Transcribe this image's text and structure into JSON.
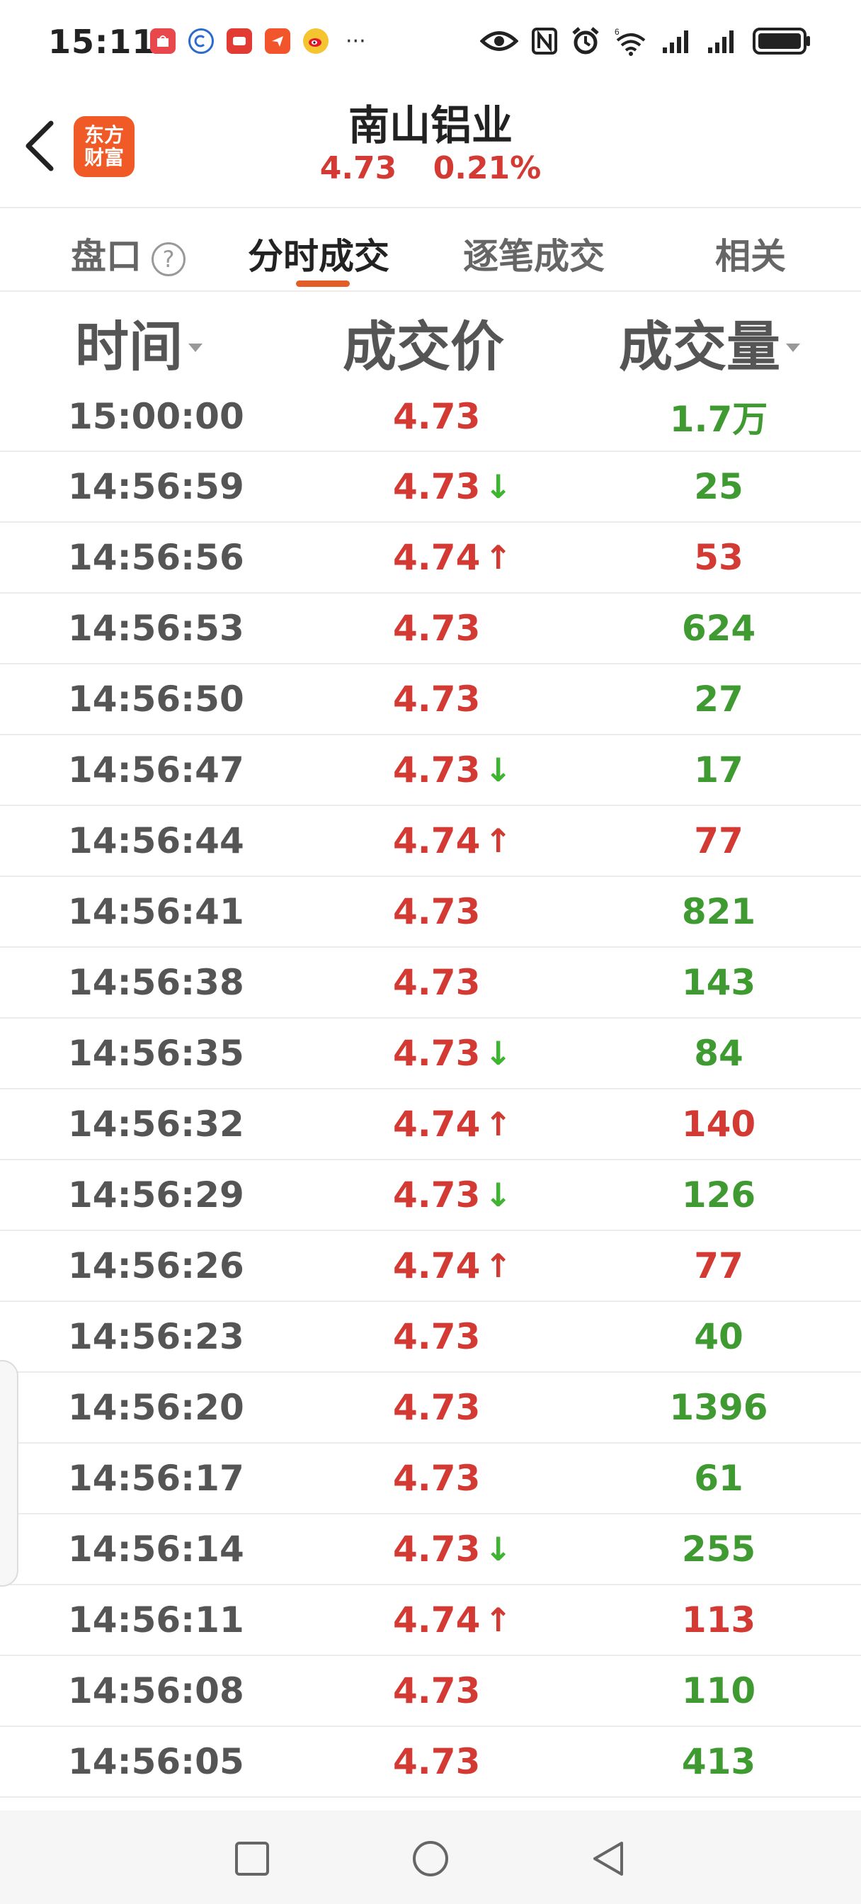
{
  "status_bar": {
    "time": "15:11",
    "more": "···",
    "app_icons": [
      "huawei-store-icon",
      "app-c-icon",
      "red-app-icon",
      "send-app-icon",
      "weibo-icon"
    ],
    "right_icons": [
      "eye-icon",
      "nfc-icon",
      "alarm-icon",
      "wifi-icon",
      "signal-icon",
      "signal-icon",
      "battery-icon"
    ]
  },
  "header": {
    "logo_line1": "东方",
    "logo_line2": "财富",
    "title": "南山铝业",
    "price": "4.73",
    "change_pct": "0.21%"
  },
  "tabs": [
    {
      "label": "盘口",
      "active": false
    },
    {
      "label": "分时成交",
      "active": true
    },
    {
      "label": "逐笔成交",
      "active": false
    },
    {
      "label": "相关",
      "active": false
    }
  ],
  "table": {
    "headers": {
      "time": "时间",
      "price": "成交价",
      "volume": "成交量"
    },
    "rows": [
      {
        "time": "15:00:00",
        "price": "4.73",
        "arrow": "",
        "volume": "1.7万",
        "vol_dir": "down"
      },
      {
        "time": "14:56:59",
        "price": "4.73",
        "arrow": "↓",
        "volume": "25",
        "vol_dir": "down"
      },
      {
        "time": "14:56:56",
        "price": "4.74",
        "arrow": "↑",
        "volume": "53",
        "vol_dir": "up"
      },
      {
        "time": "14:56:53",
        "price": "4.73",
        "arrow": "",
        "volume": "624",
        "vol_dir": "down"
      },
      {
        "time": "14:56:50",
        "price": "4.73",
        "arrow": "",
        "volume": "27",
        "vol_dir": "down"
      },
      {
        "time": "14:56:47",
        "price": "4.73",
        "arrow": "↓",
        "volume": "17",
        "vol_dir": "down"
      },
      {
        "time": "14:56:44",
        "price": "4.74",
        "arrow": "↑",
        "volume": "77",
        "vol_dir": "up"
      },
      {
        "time": "14:56:41",
        "price": "4.73",
        "arrow": "",
        "volume": "821",
        "vol_dir": "down"
      },
      {
        "time": "14:56:38",
        "price": "4.73",
        "arrow": "",
        "volume": "143",
        "vol_dir": "down"
      },
      {
        "time": "14:56:35",
        "price": "4.73",
        "arrow": "↓",
        "volume": "84",
        "vol_dir": "down"
      },
      {
        "time": "14:56:32",
        "price": "4.74",
        "arrow": "↑",
        "volume": "140",
        "vol_dir": "up"
      },
      {
        "time": "14:56:29",
        "price": "4.73",
        "arrow": "↓",
        "volume": "126",
        "vol_dir": "down"
      },
      {
        "time": "14:56:26",
        "price": "4.74",
        "arrow": "↑",
        "volume": "77",
        "vol_dir": "up"
      },
      {
        "time": "14:56:23",
        "price": "4.73",
        "arrow": "",
        "volume": "40",
        "vol_dir": "down"
      },
      {
        "time": "14:56:20",
        "price": "4.73",
        "arrow": "",
        "volume": "1396",
        "vol_dir": "down"
      },
      {
        "time": "14:56:17",
        "price": "4.73",
        "arrow": "",
        "volume": "61",
        "vol_dir": "down"
      },
      {
        "time": "14:56:14",
        "price": "4.73",
        "arrow": "↓",
        "volume": "255",
        "vol_dir": "down"
      },
      {
        "time": "14:56:11",
        "price": "4.74",
        "arrow": "↑",
        "volume": "113",
        "vol_dir": "up"
      },
      {
        "time": "14:56:08",
        "price": "4.73",
        "arrow": "",
        "volume": "110",
        "vol_dir": "down"
      },
      {
        "time": "14:56:05",
        "price": "4.73",
        "arrow": "",
        "volume": "413",
        "vol_dir": "down"
      }
    ]
  },
  "colors": {
    "up": "#d23a33",
    "down": "#3f9a32",
    "accent": "#e35e26",
    "logo_bg": "#f05a26"
  },
  "nav": {
    "buttons": [
      "recent-apps-icon",
      "home-icon",
      "back-nav-icon"
    ]
  }
}
